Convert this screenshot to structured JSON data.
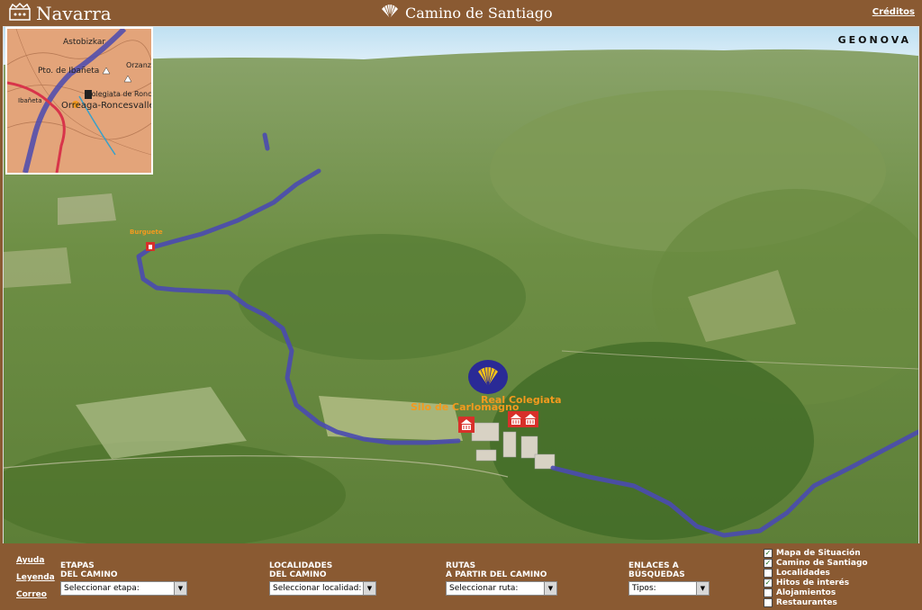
{
  "header": {
    "logo_text": "Navarra",
    "title": "Camino de Santiago",
    "credits_link": "Créditos"
  },
  "map": {
    "brand": "GEONOVA",
    "labels": {
      "carlomagno": "Silo de Carlomagno",
      "colegiata": "Real Colegiata",
      "burguete": "Burguete"
    },
    "route_color": "#4a4ab0"
  },
  "inset": {
    "labels": {
      "astobizkar": "Astobizkar",
      "ibaneta": "Pto. de Ibañeta",
      "roncesvalles": "Orreaga-Roncesvalles",
      "colegiata": "Colegiata de Roncesvalles",
      "orzanzurieta": "Orzanzurieta",
      "ibaneta_small": "Ibañeta"
    }
  },
  "bottom": {
    "links": {
      "help": "Ayuda",
      "legend": "Leyenda",
      "mail": "Correo"
    },
    "stages": {
      "cap1": "ETAPAS",
      "cap2": "DEL CAMINO",
      "value": "Seleccionar etapa:"
    },
    "towns": {
      "cap1": "LOCALIDADES",
      "cap2": "DEL CAMINO",
      "value": "Seleccionar localidad:"
    },
    "routes": {
      "cap1": "RUTAS",
      "cap2": "A PARTIR DEL CAMINO",
      "value": "Seleccionar ruta:"
    },
    "searches": {
      "cap1": "ENLACES A",
      "cap2": "BÚSQUEDAS",
      "value": "Tipos:"
    },
    "layers": [
      {
        "label": "Mapa de Situación",
        "checked": true
      },
      {
        "label": "Camino de Santiago",
        "checked": true
      },
      {
        "label": "Localidades",
        "checked": false
      },
      {
        "label": "Hitos de interés",
        "checked": true
      },
      {
        "label": "Alojamientos",
        "checked": false
      },
      {
        "label": "Restaurantes",
        "checked": false
      }
    ]
  }
}
